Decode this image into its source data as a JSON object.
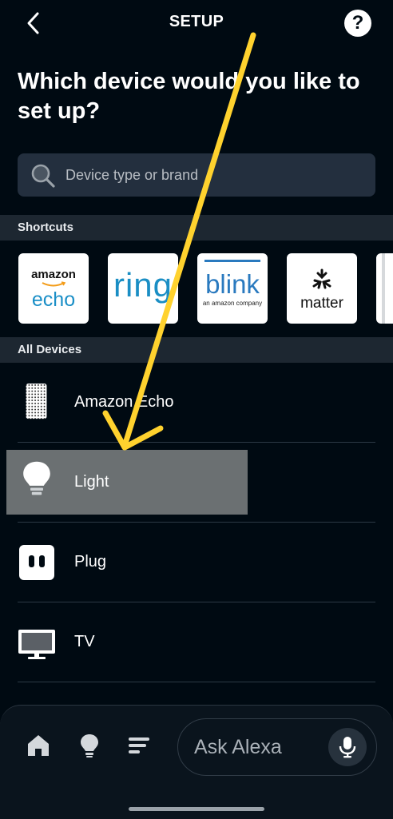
{
  "header": {
    "title": "SETUP",
    "help_label": "?"
  },
  "page": {
    "heading": "Which device would you like to set up?"
  },
  "search": {
    "placeholder": "Device type or brand"
  },
  "shortcuts": {
    "label": "Shortcuts",
    "items": [
      {
        "line1": "amazon",
        "line2": "echo"
      },
      {
        "name": "ring"
      },
      {
        "name": "blink",
        "tagline": "an amazon company"
      },
      {
        "name": "matter"
      }
    ]
  },
  "devices": {
    "label": "All Devices",
    "items": [
      {
        "label": "Amazon Echo",
        "icon": "speaker-icon"
      },
      {
        "label": "Light",
        "icon": "lightbulb-icon",
        "selected": true
      },
      {
        "label": "Plug",
        "icon": "plug-icon"
      },
      {
        "label": "TV",
        "icon": "tv-icon"
      }
    ]
  },
  "bottom_nav": {
    "alexa_label": "Ask Alexa"
  },
  "colors": {
    "background": "#000a12",
    "accent_arrow": "#ffd22e",
    "highlight": "#6b7072"
  }
}
